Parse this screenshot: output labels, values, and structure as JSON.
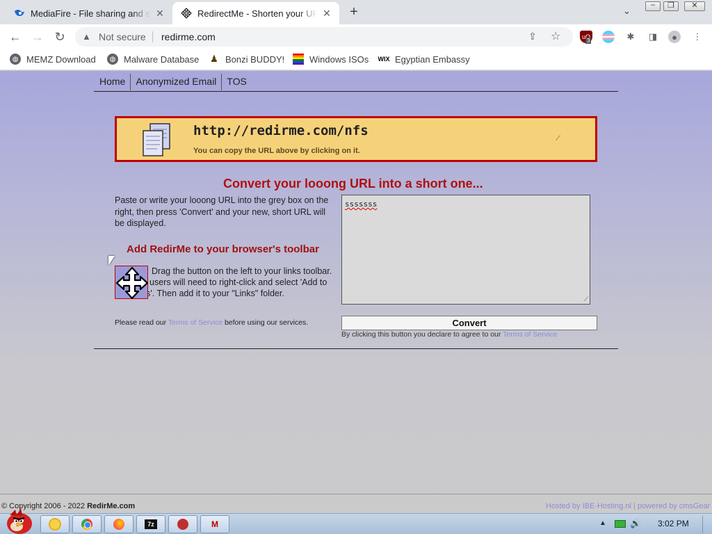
{
  "browser": {
    "tabs": [
      {
        "title": "MediaFire - File sharing and st",
        "icon": "mediafire-icon",
        "active": false
      },
      {
        "title": "RedirectMe - Shorten your UR",
        "icon": "move-arrows-icon",
        "active": true
      }
    ],
    "new_tab_symbol": "+",
    "tab_search_symbol": "⌄",
    "window_controls": {
      "minimize": "–",
      "maximize": "❐",
      "close": "✕"
    },
    "nav": {
      "back": "←",
      "forward": "→",
      "reload": "↻"
    },
    "security_icon": "▲",
    "security_label": "Not secure",
    "url": "redirme.com",
    "share_symbol": "⇪",
    "bookmark_symbol": "☆",
    "extension_badge": "3",
    "extension_symbols": {
      "ublock": "uO",
      "puzzle": "✱",
      "sidebar": "◨",
      "profile": "●",
      "menu": "⋮"
    },
    "bookmarks": [
      {
        "label": "MEMZ Download",
        "icon": "globe-icon"
      },
      {
        "label": "Malware Database",
        "icon": "globe-icon"
      },
      {
        "label": "Bonzi BUDDY!",
        "icon": "bonzi-icon"
      },
      {
        "label": "Windows ISOs",
        "icon": "rainbow-flag-icon"
      },
      {
        "label": "Egyptian Embassy",
        "icon": "wix-icon"
      }
    ],
    "globe_glyph": "◍",
    "bonzi_glyph": "♟",
    "wix_glyph": "WIX"
  },
  "site": {
    "nav_links": [
      "Home",
      "Anonymized Email",
      "TOS"
    ],
    "short_url": "http://redirme.com/nfs",
    "copy_hint": "You can copy the URL above by clicking on it.",
    "resize_glyph": "⟋",
    "headline": "Convert your looong URL into a short one...",
    "instructions": "Paste or write your looong URL into the grey box on the right, then press 'Convert' and your new, short URL will be displayed.",
    "toolbar_heading": "Add RedirMe to your browser's toolbar",
    "drag_text": "Drag the button on the left to your links toolbar. Explorer users will need to right-click and select 'Add to Favorites'. Then add it to your \"Links\" folder.",
    "terms_prefix": "Please read our ",
    "terms_link": "Terms of Service",
    "terms_suffix": " before using our services.",
    "long_url_value": "sssssss",
    "convert_label": "Convert",
    "agree_prefix": "By clicking this button you declare to agree to our ",
    "agree_link": "Terms of Service",
    "copyright_prefix": "© Copyright 2006 - 2022 ",
    "copyright_brand": "RedirMe.com",
    "hosted_by": "Hosted by IBE-Hosting.nl",
    "hosted_sep": " | ",
    "powered_by": "powered by cmsGear"
  },
  "taskbar": {
    "apps": [
      {
        "name": "weather-app",
        "icon": "sun-icon"
      },
      {
        "name": "chrome",
        "icon": "chrome-icon"
      },
      {
        "name": "firefox",
        "icon": "firefox-icon"
      },
      {
        "name": "7-zip",
        "icon": "7zip-icon",
        "label": "7z"
      },
      {
        "name": "app-5",
        "icon": "red-circle-icon"
      },
      {
        "name": "app-6",
        "icon": "m-logo-icon",
        "label": "M"
      }
    ],
    "tray_arrow": "▲",
    "volume_symbol": "🔊",
    "clock": "3:02 PM"
  },
  "colors": {
    "page_bg_top": "#a7a7dc",
    "url_box_bg": "#f5d27a",
    "url_box_border": "#c00000",
    "headline": "#b01010",
    "link": "#8b8bd8"
  }
}
